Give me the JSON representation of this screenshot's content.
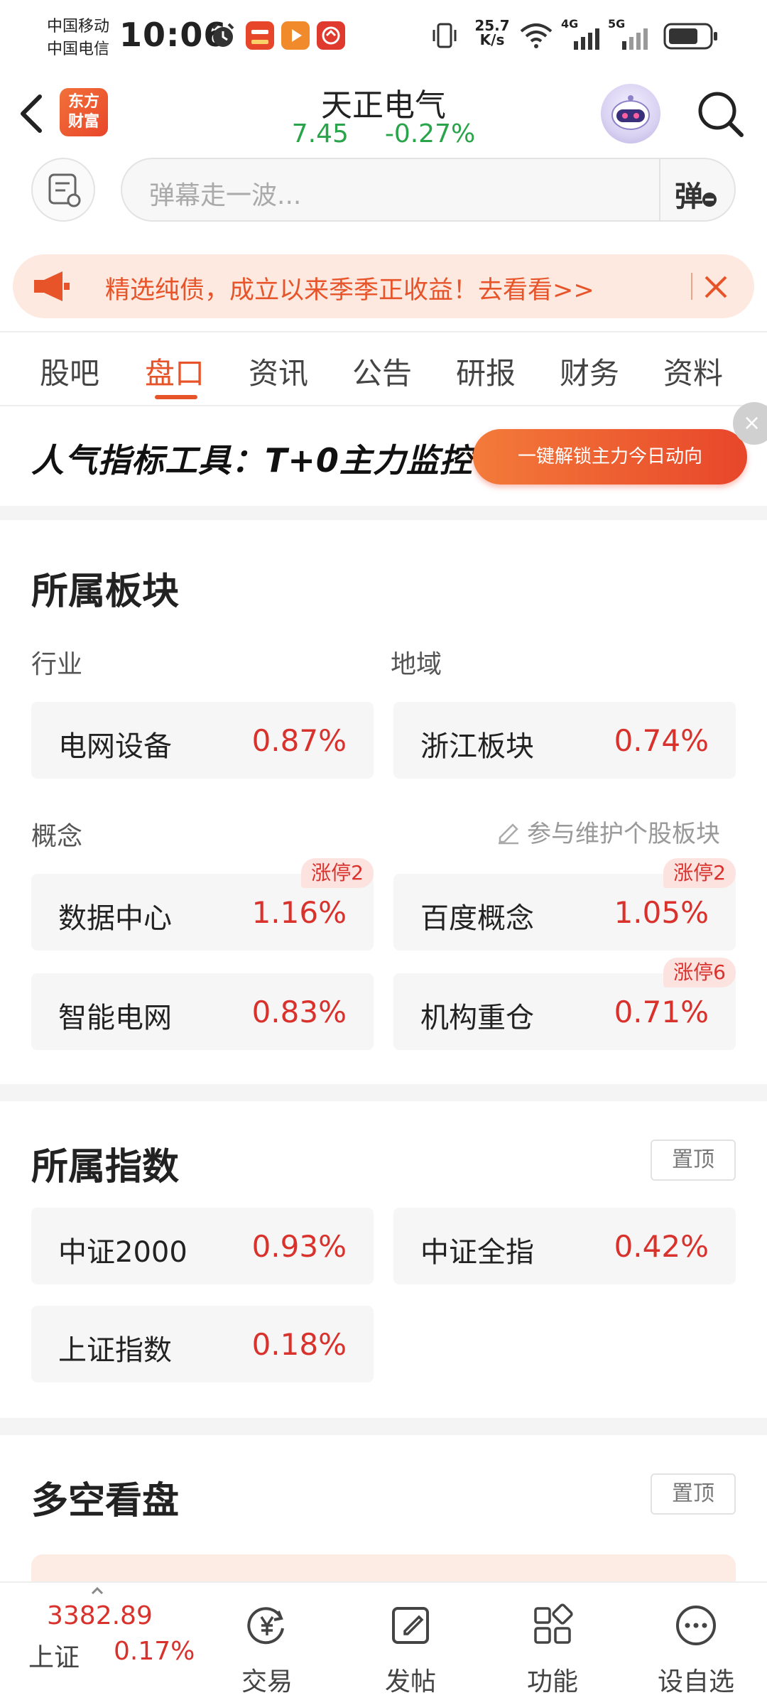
{
  "status_bar": {
    "carrier1": "中国移动",
    "carrier2": "中国电信",
    "time": "10:06",
    "net_speed_value": "25.7",
    "net_speed_unit": "K/s",
    "net_4g": "4G",
    "net_5g": "5G"
  },
  "header": {
    "logo_line1": "东方",
    "logo_line2": "财富",
    "stock_name": "天正电气",
    "price": "7.45",
    "change": "-0.27%"
  },
  "danmaku": {
    "placeholder": "弹幕走一波...",
    "button_label": "弹"
  },
  "promo": {
    "text": "精选纯债，成立以来季季正收益！去看看>>"
  },
  "tabs": [
    {
      "label": "股吧"
    },
    {
      "label": "盘口"
    },
    {
      "label": "资讯"
    },
    {
      "label": "公告"
    },
    {
      "label": "研报"
    },
    {
      "label": "财务"
    },
    {
      "label": "资料"
    }
  ],
  "active_tab": "盘口",
  "tool_ad": {
    "text": "人气指标工具：T+0主力监控",
    "button": "一键解锁主力今日动向"
  },
  "sectors": {
    "title": "所属板块",
    "industry_label": "行业",
    "region_label": "地域",
    "industry": {
      "name": "电网设备",
      "pct": "0.87%"
    },
    "region": {
      "name": "浙江板块",
      "pct": "0.74%"
    },
    "concept_label": "概念",
    "maintain_link": "参与维护个股板块",
    "concepts": [
      {
        "name": "数据中心",
        "pct": "1.16%",
        "tag": "涨停2"
      },
      {
        "name": "百度概念",
        "pct": "1.05%",
        "tag": "涨停2"
      },
      {
        "name": "智能电网",
        "pct": "0.83%",
        "tag": ""
      },
      {
        "name": "机构重仓",
        "pct": "0.71%",
        "tag": "涨停6"
      }
    ]
  },
  "indices": {
    "title": "所属指数",
    "pin_label": "置顶",
    "items": [
      {
        "name": "中证2000",
        "pct": "0.93%"
      },
      {
        "name": "中证全指",
        "pct": "0.42%"
      },
      {
        "name": "上证指数",
        "pct": "0.18%"
      }
    ]
  },
  "bull_bear": {
    "title": "多空看盘",
    "pin_label": "置顶"
  },
  "bottom_bar": {
    "index_value": "3382.89",
    "index_name": "上证",
    "index_pct": "0.17%",
    "nav": [
      {
        "label": "交易",
        "icon": "trade-yen-icon"
      },
      {
        "label": "发帖",
        "icon": "compose-icon"
      },
      {
        "label": "功能",
        "icon": "grid-icon"
      },
      {
        "label": "设自选",
        "icon": "more-dots-icon"
      }
    ]
  },
  "colors": {
    "accent": "#e8542a",
    "up": "#d9312c",
    "down": "#2aa44a"
  }
}
